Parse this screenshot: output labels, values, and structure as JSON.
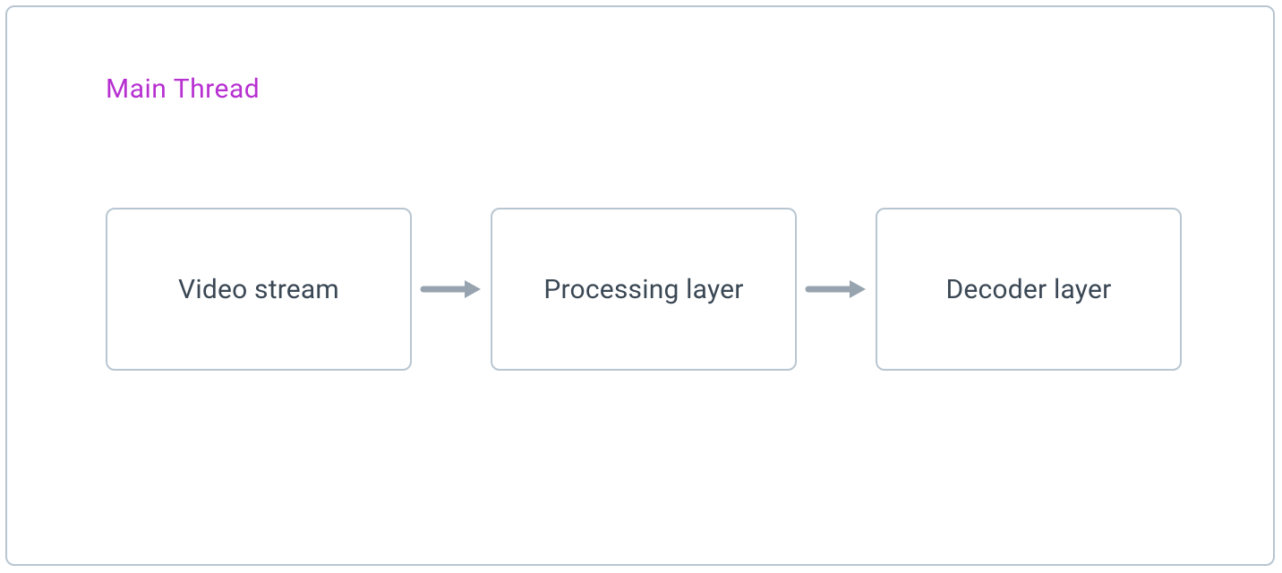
{
  "title": "Main Thread",
  "nodes": {
    "n1": "Video stream",
    "n2": "Processing layer",
    "n3": "Decoder layer"
  },
  "colors": {
    "title": "#b730d1",
    "border": "#b8c6d1",
    "text": "#3a4754",
    "arrow": "#97a3ae"
  }
}
